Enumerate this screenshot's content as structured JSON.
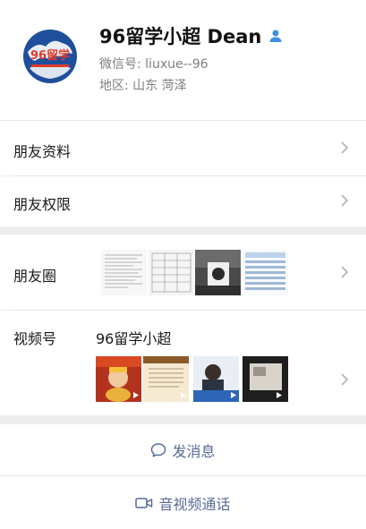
{
  "profile": {
    "name": "96留学小超  Dean",
    "wechat_id": "微信号: liuxue--96",
    "region": "地区: 山东 菏泽",
    "avatar": {
      "logo_text": "96留学"
    }
  },
  "rows": {
    "friend_info": "朋友资料",
    "friend_permissions": "朋友权限",
    "moments": "朋友圈",
    "channels": "视频号",
    "channels_name": "96留学小超"
  },
  "actions": {
    "send_message": "发消息",
    "video_call": "音视频通话"
  },
  "colors": {
    "accent_link": "#576b95",
    "person_icon": "#3d8de2",
    "page_bg": "#ededed"
  },
  "icons": {
    "person": "person-icon",
    "chevron": "chevron-right-icon",
    "message": "chat-bubble-icon",
    "video": "video-camera-icon",
    "play": "play-icon"
  }
}
